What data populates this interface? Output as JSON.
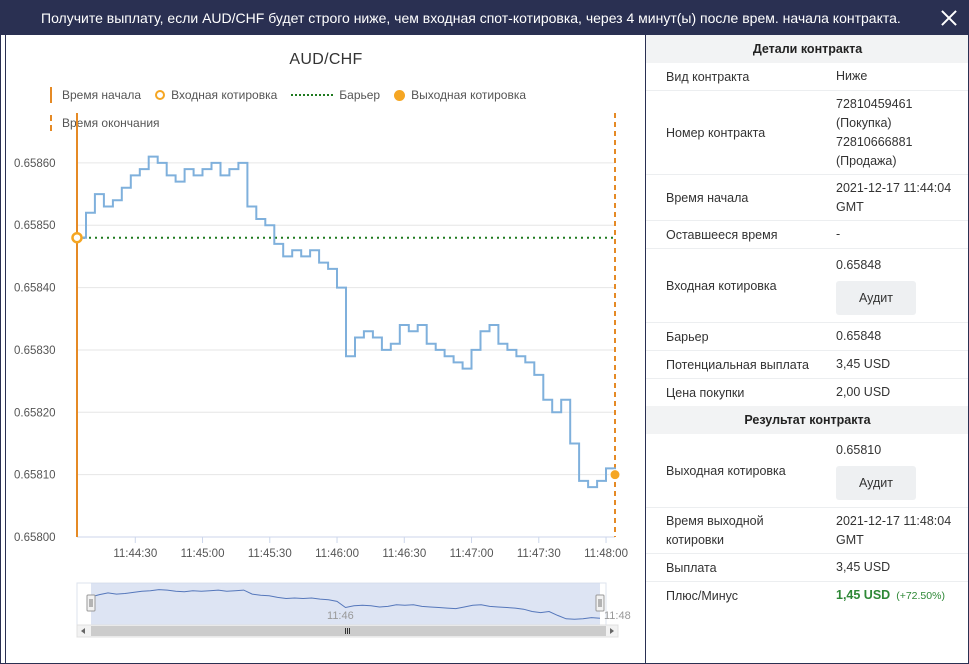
{
  "title": "Получите выплату, если AUD/CHF будет строго ниже, чем входная спот-котировка, через 4 минут(ы) после врем. начала контракта.",
  "chart": {
    "title": "AUD/CHF",
    "legend": {
      "start_time": "Время начала",
      "entry_spot": "Входная котировка",
      "barrier": "Барьер",
      "exit_spot": "Выходная котировка",
      "end_time": "Время окончания"
    },
    "nav_labels": [
      "11:46",
      "11:48"
    ]
  },
  "chart_data": {
    "type": "line",
    "title": "AUD/CHF",
    "xlabel": "",
    "ylabel": "",
    "x_ticks": [
      "11:44:30",
      "11:45:00",
      "11:45:30",
      "11:46:00",
      "11:46:30",
      "11:47:00",
      "11:47:30",
      "11:48:00"
    ],
    "y_ticks": [
      "0.65800",
      "0.65810",
      "0.65820",
      "0.65830",
      "0.65840",
      "0.65850",
      "0.65860"
    ],
    "ylim": [
      0.658,
      0.65868
    ],
    "start_time": "11:44:04",
    "end_time": "11:48:04",
    "entry_spot": 0.65848,
    "barrier": 0.65848,
    "exit_spot": 0.6581,
    "series": [
      {
        "x": [
          "11:44:04",
          "11:44:08",
          "11:44:12",
          "11:44:16",
          "11:44:20",
          "11:44:24",
          "11:44:28",
          "11:44:32",
          "11:44:36",
          "11:44:40",
          "11:44:44",
          "11:44:48",
          "11:44:52",
          "11:44:56",
          "11:45:00",
          "11:45:04",
          "11:45:08",
          "11:45:12",
          "11:45:16",
          "11:45:20",
          "11:45:24",
          "11:45:28",
          "11:45:32",
          "11:45:36",
          "11:45:40",
          "11:45:44",
          "11:45:48",
          "11:45:52",
          "11:45:56",
          "11:46:00",
          "11:46:04",
          "11:46:08",
          "11:46:12",
          "11:46:16",
          "11:46:20",
          "11:46:24",
          "11:46:28",
          "11:46:32",
          "11:46:36",
          "11:46:40",
          "11:46:44",
          "11:46:48",
          "11:46:52",
          "11:46:56",
          "11:47:00",
          "11:47:04",
          "11:47:08",
          "11:47:12",
          "11:47:16",
          "11:47:20",
          "11:47:24",
          "11:47:28",
          "11:47:32",
          "11:47:36",
          "11:47:40",
          "11:47:44",
          "11:47:48",
          "11:47:52",
          "11:47:56",
          "11:48:00",
          "11:48:04"
        ],
        "values": [
          0.65848,
          0.65852,
          0.65855,
          0.65853,
          0.65854,
          0.65856,
          0.65858,
          0.65859,
          0.65861,
          0.6586,
          0.65858,
          0.65857,
          0.65859,
          0.65858,
          0.65859,
          0.6586,
          0.65858,
          0.65859,
          0.6586,
          0.65853,
          0.65851,
          0.6585,
          0.65847,
          0.65845,
          0.65846,
          0.65845,
          0.65846,
          0.65844,
          0.65843,
          0.6584,
          0.65829,
          0.65832,
          0.65833,
          0.65832,
          0.6583,
          0.65831,
          0.65834,
          0.65833,
          0.65834,
          0.65831,
          0.6583,
          0.65829,
          0.65828,
          0.65827,
          0.6583,
          0.65833,
          0.65834,
          0.65831,
          0.6583,
          0.65829,
          0.65828,
          0.65826,
          0.65822,
          0.6582,
          0.65822,
          0.65815,
          0.65809,
          0.65808,
          0.65809,
          0.65811,
          0.6581
        ]
      }
    ]
  },
  "details": {
    "header": "Детали контракта",
    "rows": {
      "type": {
        "label": "Вид контракта",
        "value": "Ниже"
      },
      "number": {
        "label": "Номер контракта",
        "value_buy": "72810459461",
        "value_buy_note": "(Покупка)",
        "value_sell": "72810666881",
        "value_sell_note": "(Продажа)"
      },
      "start": {
        "label": "Время начала",
        "value": "2021-12-17 11:44:04",
        "value2": "GMT"
      },
      "remaining": {
        "label": "Оставшееся время",
        "value": "-"
      },
      "entry": {
        "label": "Входная котировка",
        "value": "0.65848",
        "audit": "Аудит"
      },
      "barrier": {
        "label": "Барьер",
        "value": "0.65848"
      },
      "payout": {
        "label": "Потенциальная выплата",
        "value": "3,45 USD"
      },
      "price": {
        "label": "Цена покупки",
        "value": "2,00 USD"
      }
    }
  },
  "result": {
    "header": "Результат контракта",
    "rows": {
      "exit": {
        "label": "Выходная котировка",
        "value": "0.65810",
        "audit": "Аудит"
      },
      "exit_time": {
        "label": "Время выходной",
        "label2": "котировки",
        "value": "2021-12-17 11:48:04",
        "value2": "GMT"
      },
      "payout": {
        "label": "Выплата",
        "value": "3,45 USD"
      },
      "pnl": {
        "label": "Плюс/Минус",
        "value": "1,45 USD",
        "pct": "(+72.50%)"
      }
    }
  },
  "colors": {
    "header_bg": "#2a3052",
    "line": "#7fb0dc",
    "start_end": "#e58a25",
    "barrier": "#1f7a1f",
    "spot": "#f5a623",
    "profit": "#2e8836"
  }
}
